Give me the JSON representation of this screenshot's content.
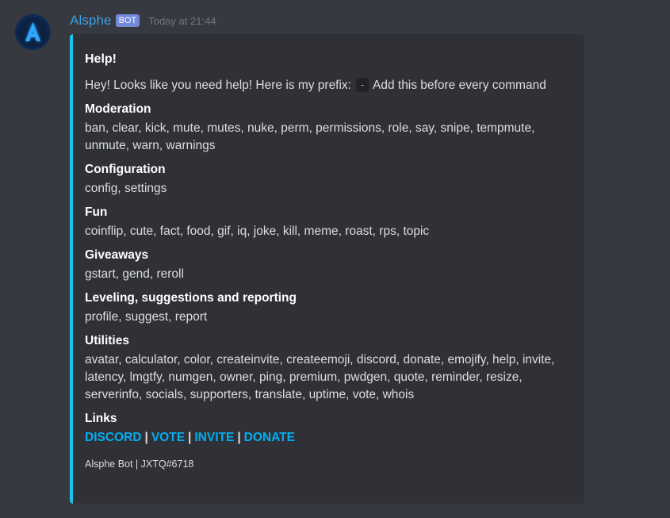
{
  "colors": {
    "background": "#36393f",
    "embed_accent": "#1ec4e6",
    "link": "#00aff4",
    "username": "#3aa0e6",
    "bot_tag": "#7289da"
  },
  "message": {
    "author": "Alsphe",
    "bot_tag": "BOT",
    "timestamp": "Today at 21:44",
    "avatar_icon": "letter-a-logo-icon",
    "avatar_letter": "A"
  },
  "embed": {
    "title": "Help!",
    "description_before": "Hey! Looks like you need help! Here is my prefix:",
    "prefix": "-",
    "description_after": "Add this before every command",
    "fields": [
      {
        "name": "Moderation",
        "value": "ban, clear, kick, mute, mutes, nuke, perm, permissions, role, say, snipe, tempmute, unmute, warn, warnings"
      },
      {
        "name": "Configuration",
        "value": "config, settings"
      },
      {
        "name": "Fun",
        "value": "coinflip, cute, fact, food, gif, iq, joke, kill, meme, roast, rps, topic"
      },
      {
        "name": "Giveaways",
        "value": "gstart, gend, reroll"
      },
      {
        "name": "Leveling, suggestions and reporting",
        "value": "profile, suggest, report"
      },
      {
        "name": "Utilities",
        "value": "avatar, calculator, color, createinvite, createemoji, discord, donate, emojify, help, invite, latency, lmgtfy, numgen, owner, ping, premium, pwdgen, quote, reminder, resize, serverinfo, socials, supporters, translate, uptime, vote, whois"
      }
    ],
    "links_title": "Links",
    "links": [
      "DISCORD",
      "VOTE",
      "INVITE",
      "DONATE"
    ],
    "link_separator": "|",
    "footer": "Alsphe Bot | JXTQ#6718"
  }
}
